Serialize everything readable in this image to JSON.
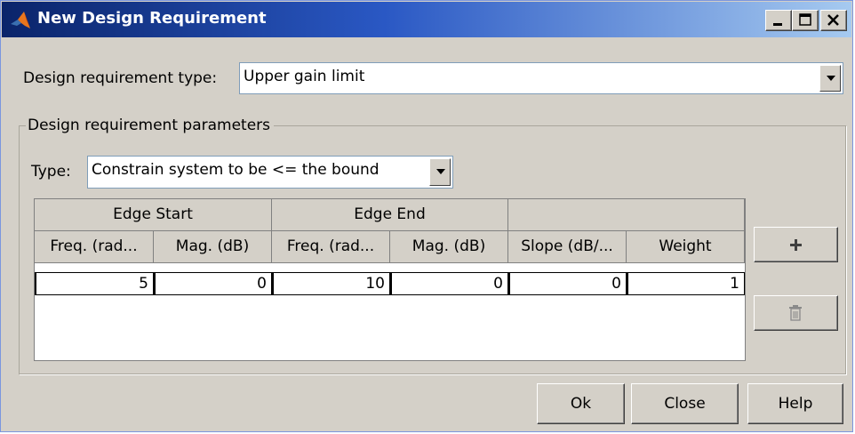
{
  "window": {
    "title": "New Design Requirement",
    "minimize_label": "_",
    "maximize_label": "□",
    "close_label": "×"
  },
  "requirement_type": {
    "label": "Design requirement type:",
    "value": "Upper gain limit"
  },
  "parameters": {
    "group_label": "Design requirement parameters",
    "type_label": "Type:",
    "type_value": "Constrain system to be <= the bound"
  },
  "table": {
    "group_headers": [
      "Edge Start",
      "Edge End",
      ""
    ],
    "columns": [
      "Freq. (rad...",
      "Mag. (dB)",
      "Freq. (rad...",
      "Mag. (dB)",
      "Slope (dB/...",
      "Weight"
    ],
    "rows": [
      [
        "5",
        "0",
        "10",
        "0",
        "0",
        "1"
      ]
    ]
  },
  "side_buttons": {
    "add_icon": "plus-icon",
    "delete_icon": "trash-icon"
  },
  "footer": {
    "ok_label": "Ok",
    "close_label": "Close",
    "help_label": "Help"
  }
}
